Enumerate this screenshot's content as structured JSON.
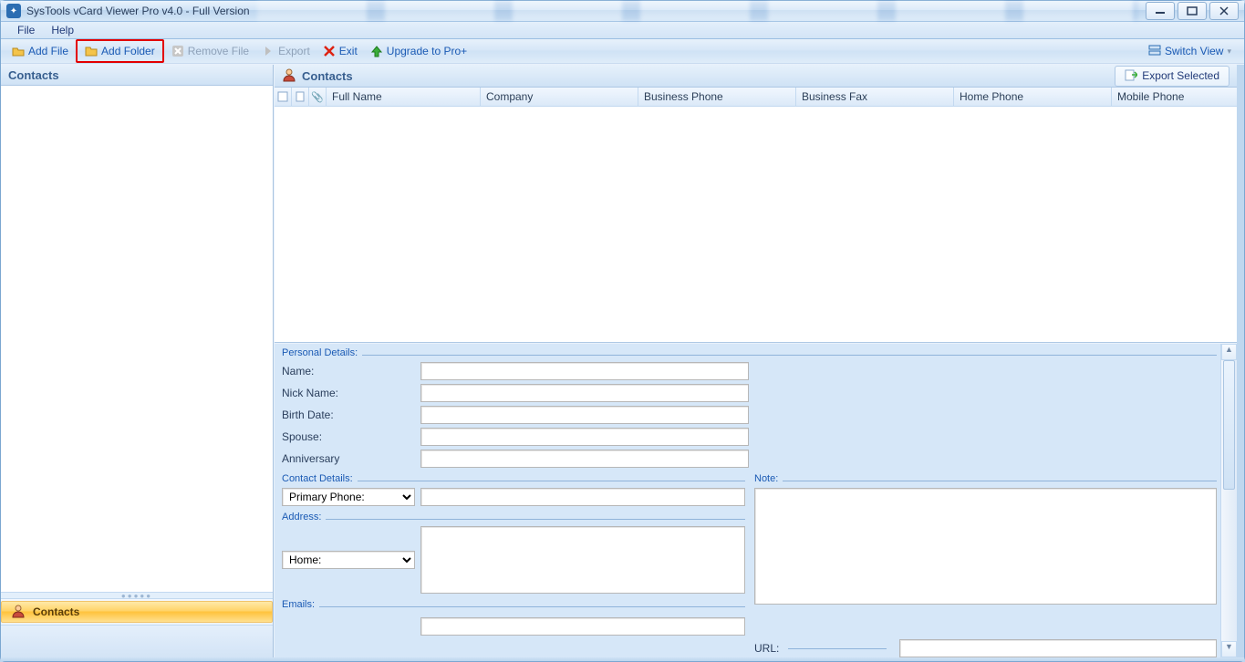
{
  "window": {
    "title": "SysTools vCard Viewer Pro v4.0 - Full Version"
  },
  "menubar": {
    "file": "File",
    "help": "Help"
  },
  "toolbar": {
    "add_file": "Add File",
    "add_folder": "Add Folder",
    "remove_file": "Remove File",
    "export": "Export",
    "exit": "Exit",
    "upgrade": "Upgrade to Pro+",
    "switch_view": "Switch View"
  },
  "left_pane": {
    "header": "Contacts",
    "nav_contacts": "Contacts"
  },
  "right_pane": {
    "header": "Contacts",
    "export_selected": "Export Selected",
    "columns": {
      "full_name": "Full Name",
      "company": "Company",
      "business_phone": "Business Phone",
      "business_fax": "Business Fax",
      "home_phone": "Home Phone",
      "mobile_phone": "Mobile Phone"
    }
  },
  "details": {
    "personal": {
      "legend": "Personal Details:",
      "name": "Name:",
      "nick_name": "Nick Name:",
      "birth_date": "Birth Date:",
      "spouse": "Spouse:",
      "anniversary": "Anniversary"
    },
    "contact": {
      "legend": "Contact Details:",
      "primary_phone_option": "Primary Phone:"
    },
    "address": {
      "legend": "Address:",
      "home_option": "Home:"
    },
    "emails": {
      "legend": "Emails:"
    },
    "note": {
      "legend": "Note:"
    },
    "url": {
      "legend": "URL:"
    }
  }
}
